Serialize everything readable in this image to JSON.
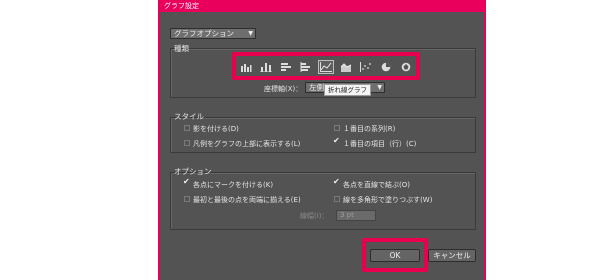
{
  "window": {
    "title": "グラフ設定"
  },
  "panel_selector": {
    "value": "グラフオプション"
  },
  "type_group": {
    "label": "種類",
    "icons": [
      "grouped-column-graph-icon",
      "stacked-column-graph-icon",
      "bar-graph-icon",
      "stacked-bar-graph-icon",
      "line-graph-icon",
      "area-graph-icon",
      "scatter-graph-icon",
      "pie-graph-icon",
      "radar-graph-icon"
    ],
    "selected_index": 4,
    "tooltip": "折れ線グラフ",
    "axis_label": "座標軸(X)：",
    "axis_value": "左側"
  },
  "style_group": {
    "label": "スタイル",
    "options": {
      "shadow": {
        "label": "影を付ける(D)",
        "checked": false
      },
      "legend_top": {
        "label": "凡例をグラフの上部に表示する(L)",
        "checked": false
      },
      "first_row_front": {
        "label": "１番目の系列(R)",
        "checked": false
      },
      "first_column_front": {
        "label": "１番目の項目（行）(C)",
        "checked": true
      }
    }
  },
  "options_group": {
    "label": "オプション",
    "options": {
      "mark_points": {
        "label": "各点にマークを付ける(K)",
        "checked": true
      },
      "connect_points": {
        "label": "各点を直線で結ぶ(O)",
        "checked": true
      },
      "edge_to_edge": {
        "label": "最初と最後の点を両端に揃える(E)",
        "checked": false
      },
      "filled_lines": {
        "label": "線を多角形で塗りつぶす(W)",
        "checked": false
      }
    },
    "line_width_label": "線幅(I)：",
    "line_width_value": "3 pt"
  },
  "buttons": {
    "ok": "OK",
    "cancel": "キャンセル"
  },
  "colors": {
    "accent": "#e8005c",
    "highlight": "#e8004f",
    "panel": "#535353"
  }
}
